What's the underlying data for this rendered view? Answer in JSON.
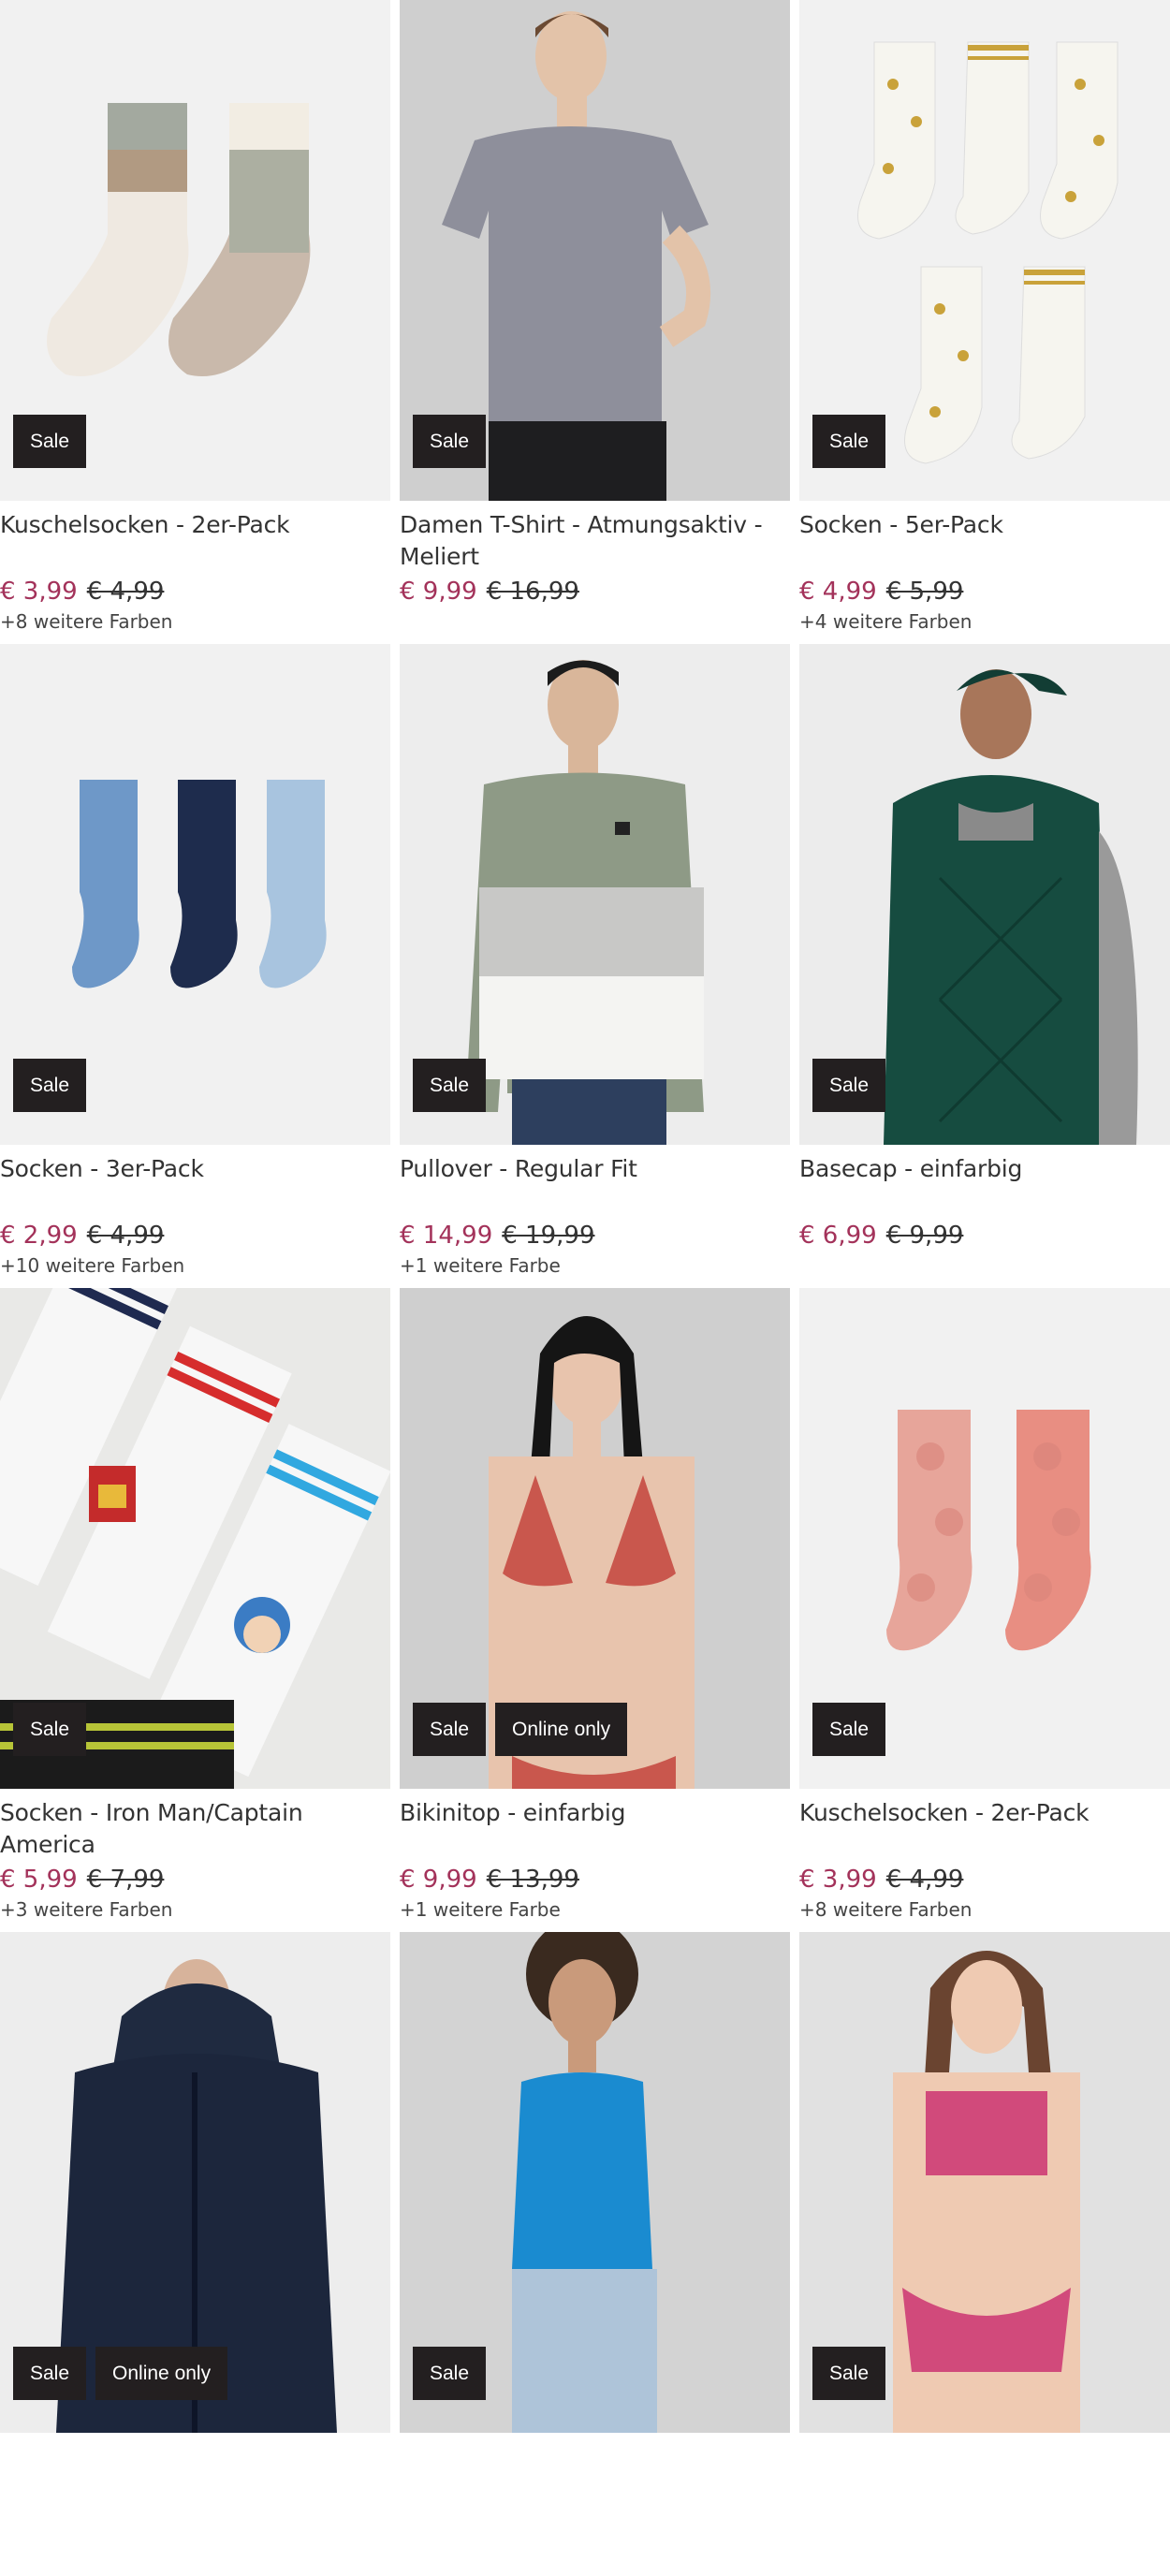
{
  "products": [
    {
      "title": "Kuschelsocken - 2er-Pack",
      "price": "€ 3,99",
      "old_price": "€ 4,99",
      "colors": "+8 weitere Farben",
      "badges": [
        "Sale"
      ],
      "image": "socks-pair-beige-sage"
    },
    {
      "title": "Damen T-Shirt - Atmungsaktiv - Meliert",
      "price": "€ 9,99",
      "old_price": "€ 16,99",
      "colors": "",
      "badges": [
        "Sale"
      ],
      "image": "woman-grey-tshirt"
    },
    {
      "title": "Socken - 5er-Pack",
      "price": "€ 4,99",
      "old_price": "€ 5,99",
      "colors": "+4 weitere Farben",
      "badges": [
        "Sale"
      ],
      "image": "white-star-socks"
    },
    {
      "title": "Socken - 3er-Pack",
      "price": "€ 2,99",
      "old_price": "€ 4,99",
      "colors": "+10 weitere Farben",
      "badges": [
        "Sale"
      ],
      "image": "blue-socks-three"
    },
    {
      "title": "Pullover - Regular Fit",
      "price": "€ 14,99",
      "old_price": "€ 19,99",
      "colors": "+1 weitere Farbe",
      "badges": [
        "Sale"
      ],
      "image": "man-striped-pullover"
    },
    {
      "title": "Basecap - einfarbig",
      "price": "€ 6,99",
      "old_price": "€ 9,99",
      "colors": "",
      "badges": [
        "Sale"
      ],
      "image": "woman-green-cap-vest"
    },
    {
      "title": "Socken - Iron Man/Captain America",
      "price": "€ 5,99",
      "old_price": "€ 7,99",
      "colors": "+3 weitere Farben",
      "badges": [
        "Sale"
      ],
      "image": "marvel-socks"
    },
    {
      "title": "Bikinitop - einfarbig",
      "price": "€ 9,99",
      "old_price": "€ 13,99",
      "colors": "+1 weitere Farbe",
      "badges": [
        "Sale",
        "Online only"
      ],
      "image": "woman-red-bikini"
    },
    {
      "title": "Kuschelsocken - 2er-Pack",
      "price": "€ 3,99",
      "old_price": "€ 4,99",
      "colors": "+8 weitere Farben",
      "badges": [
        "Sale"
      ],
      "image": "pink-fluffy-socks"
    },
    {
      "title": "",
      "price": "",
      "old_price": "",
      "colors": "",
      "badges": [
        "Sale",
        "Online only"
      ],
      "image": "man-navy-raincoat"
    },
    {
      "title": "",
      "price": "",
      "old_price": "",
      "colors": "",
      "badges": [
        "Sale"
      ],
      "image": "woman-blue-tanktop"
    },
    {
      "title": "",
      "price": "",
      "old_price": "",
      "colors": "",
      "badges": [
        "Sale"
      ],
      "image": "woman-pink-bikini"
    }
  ],
  "colors": {
    "sale_price": "#a3325a",
    "badge_bg": "#231f20",
    "image_bg": "#eeeeee"
  }
}
